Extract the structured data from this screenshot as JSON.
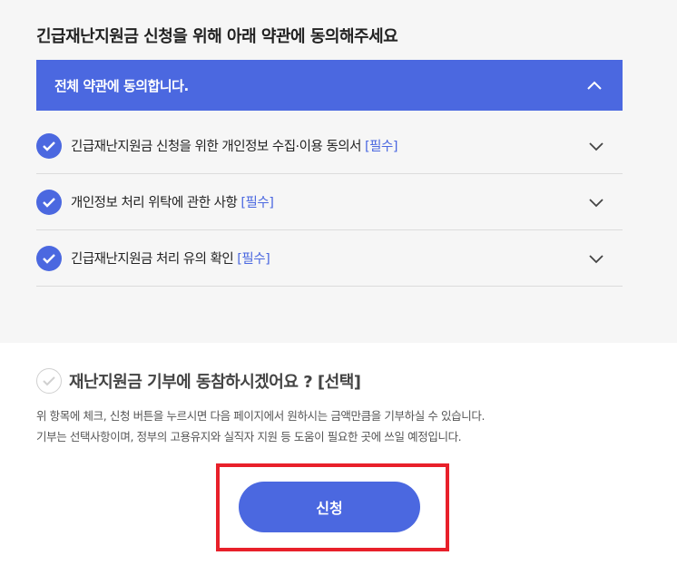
{
  "heading": "긴급재난지원금 신청을 위해 아래 약관에 동의해주세요",
  "agree_all": {
    "label": "전체 약관에 동의합니다."
  },
  "terms": [
    {
      "label": "긴급재난지원금 신청을 위한 개인정보 수집·이용 동의서",
      "tag": "[필수]"
    },
    {
      "label": "개인정보 처리 위탁에 관한 사항",
      "tag": "[필수]"
    },
    {
      "label": "긴급재난지원금 처리 유의 확인",
      "tag": "[필수]"
    }
  ],
  "donation": {
    "label": "재난지원금 기부에 동참하시겠어요 ? [선택]",
    "desc_line1": "위 항목에 체크, 신청 버튼을 누르시면 다음 페이지에서 원하시는 금액만큼을 기부하실 수 있습니다.",
    "desc_line2": "기부는 선택사항이며, 정부의 고용유지와 실직자 지원 등 도움이 필요한 곳에 쓰일 예정입니다."
  },
  "apply_button": "신청",
  "colors": {
    "accent": "#4b68e0",
    "highlight": "#e8202a"
  }
}
